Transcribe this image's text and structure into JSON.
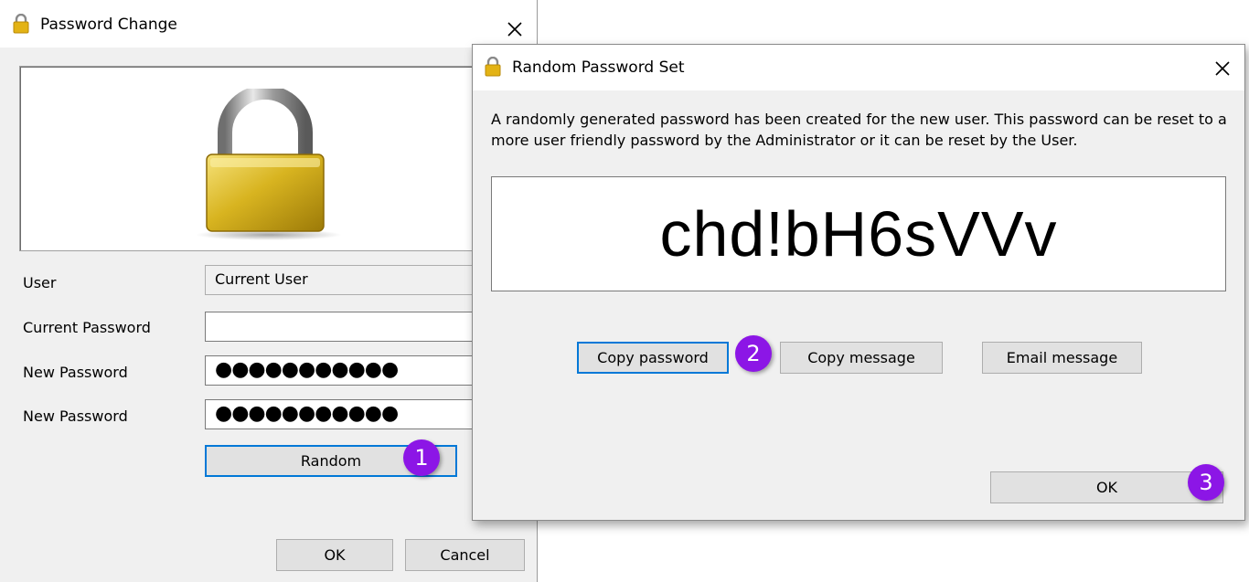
{
  "password_change": {
    "title": "Password Change",
    "fields": [
      {
        "label": "User",
        "value": "Current User"
      },
      {
        "label": "Current Password",
        "value": ""
      },
      {
        "label": "New Password",
        "value": "●●●●●●●●●●●"
      },
      {
        "label": "New Password",
        "value": "●●●●●●●●●●●"
      }
    ],
    "random_label": "Random",
    "ok_label": "OK",
    "cancel_label": "Cancel"
  },
  "random_password_set": {
    "title": "Random Password Set",
    "message": "A randomly generated password has been created for the new user. This password can be reset to a more user friendly password by the Administrator or it can be reset by the User.",
    "password": "chd!bH6sVVv",
    "copy_password_label": "Copy password",
    "copy_message_label": "Copy message",
    "email_message_label": "Email message",
    "ok_label": "OK"
  },
  "step_badges": [
    "1",
    "2",
    "3"
  ],
  "icons": {
    "title_icon": "lock-icon",
    "close": "close-icon",
    "hero": "padlock-image"
  },
  "colors": {
    "step_badge": "#8c16e6",
    "focus_border": "#0078d7",
    "padlock_gold": "#d8b420"
  }
}
